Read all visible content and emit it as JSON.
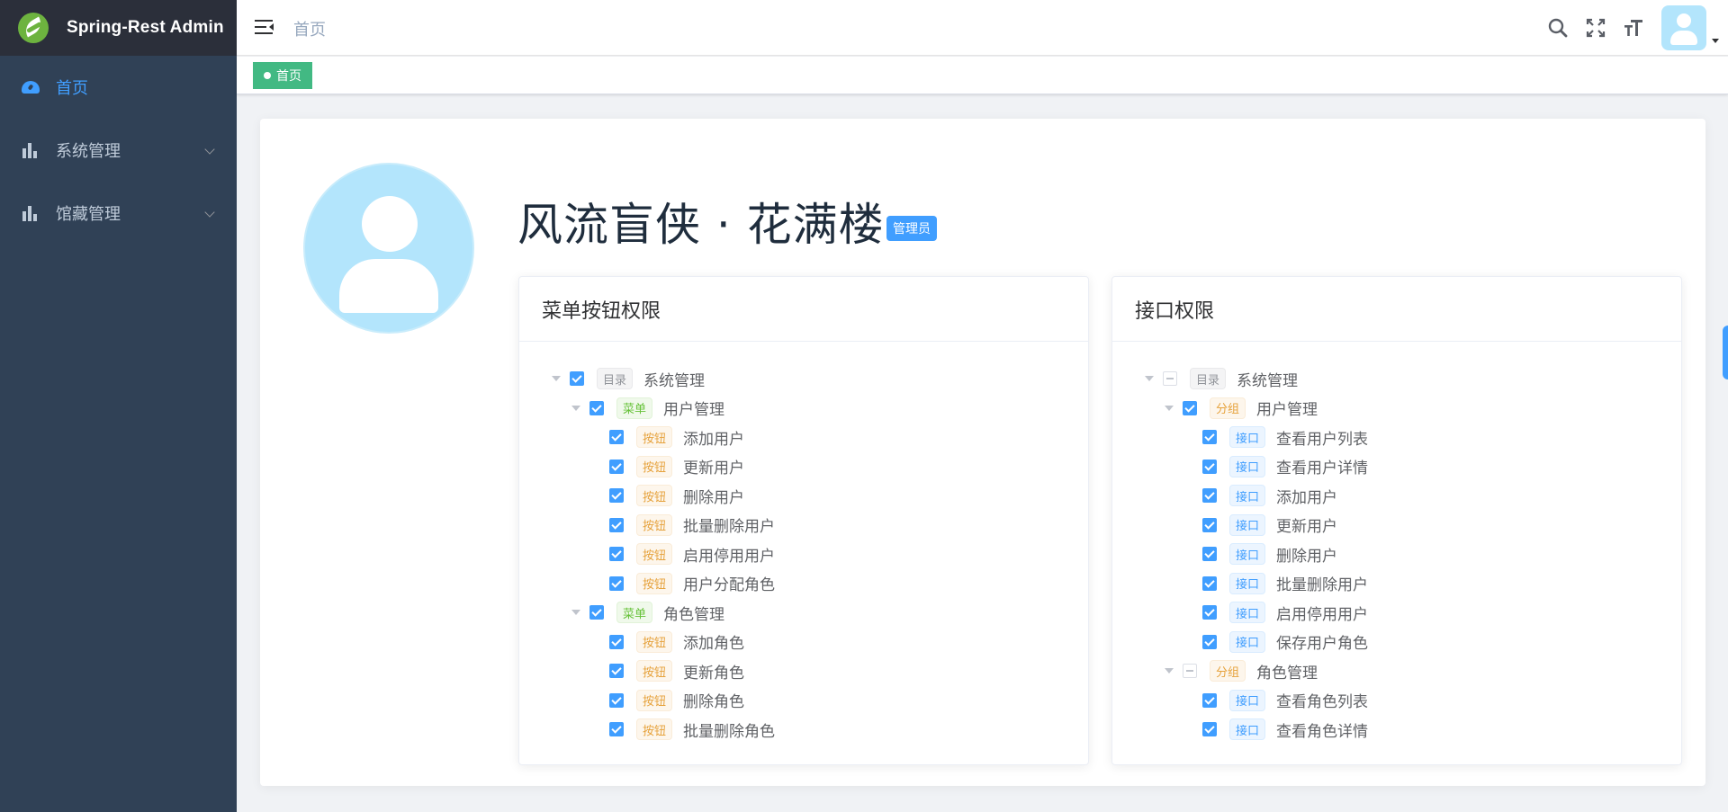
{
  "app": {
    "title": "Spring-Rest Admin"
  },
  "sidebar": {
    "items": [
      {
        "label": "首页",
        "icon": "dashboard-icon",
        "active": true
      },
      {
        "label": "系统管理",
        "icon": "bar-chart-icon",
        "expandable": true
      },
      {
        "label": "馆藏管理",
        "icon": "bar-chart-icon",
        "expandable": true
      }
    ]
  },
  "navbar": {
    "breadcrumb": "首页",
    "tools": [
      "search-icon",
      "fullscreen-icon",
      "font-size-icon"
    ]
  },
  "tags": {
    "active": "首页"
  },
  "profile": {
    "name": "风流盲侠 · 花满楼",
    "role": "管理员"
  },
  "menu_permissions": {
    "title": "菜单按钮权限",
    "nodes": [
      {
        "depth": 0,
        "expand": true,
        "check": "checked",
        "badge": "目录",
        "badge_type": "info",
        "label": "系统管理"
      },
      {
        "depth": 1,
        "expand": true,
        "check": "checked",
        "badge": "菜单",
        "badge_type": "success",
        "label": "用户管理"
      },
      {
        "depth": 2,
        "expand": false,
        "check": "checked",
        "badge": "按钮",
        "badge_type": "warning",
        "label": "添加用户"
      },
      {
        "depth": 2,
        "expand": false,
        "check": "checked",
        "badge": "按钮",
        "badge_type": "warning",
        "label": "更新用户"
      },
      {
        "depth": 2,
        "expand": false,
        "check": "checked",
        "badge": "按钮",
        "badge_type": "warning",
        "label": "删除用户"
      },
      {
        "depth": 2,
        "expand": false,
        "check": "checked",
        "badge": "按钮",
        "badge_type": "warning",
        "label": "批量删除用户"
      },
      {
        "depth": 2,
        "expand": false,
        "check": "checked",
        "badge": "按钮",
        "badge_type": "warning",
        "label": "启用停用用户"
      },
      {
        "depth": 2,
        "expand": false,
        "check": "checked",
        "badge": "按钮",
        "badge_type": "warning",
        "label": "用户分配角色"
      },
      {
        "depth": 1,
        "expand": true,
        "check": "checked",
        "badge": "菜单",
        "badge_type": "success",
        "label": "角色管理"
      },
      {
        "depth": 2,
        "expand": false,
        "check": "checked",
        "badge": "按钮",
        "badge_type": "warning",
        "label": "添加角色"
      },
      {
        "depth": 2,
        "expand": false,
        "check": "checked",
        "badge": "按钮",
        "badge_type": "warning",
        "label": "更新角色"
      },
      {
        "depth": 2,
        "expand": false,
        "check": "checked",
        "badge": "按钮",
        "badge_type": "warning",
        "label": "删除角色"
      },
      {
        "depth": 2,
        "expand": false,
        "check": "checked",
        "badge": "按钮",
        "badge_type": "warning",
        "label": "批量删除角色"
      }
    ]
  },
  "api_permissions": {
    "title": "接口权限",
    "nodes": [
      {
        "depth": 0,
        "expand": true,
        "check": "indeterminate",
        "badge": "目录",
        "badge_type": "info",
        "label": "系统管理"
      },
      {
        "depth": 1,
        "expand": true,
        "check": "checked",
        "badge": "分组",
        "badge_type": "warning",
        "label": "用户管理"
      },
      {
        "depth": 2,
        "expand": false,
        "check": "checked",
        "badge": "接口",
        "badge_type": "primary",
        "label": "查看用户列表"
      },
      {
        "depth": 2,
        "expand": false,
        "check": "checked",
        "badge": "接口",
        "badge_type": "primary",
        "label": "查看用户详情"
      },
      {
        "depth": 2,
        "expand": false,
        "check": "checked",
        "badge": "接口",
        "badge_type": "primary",
        "label": "添加用户"
      },
      {
        "depth": 2,
        "expand": false,
        "check": "checked",
        "badge": "接口",
        "badge_type": "primary",
        "label": "更新用户"
      },
      {
        "depth": 2,
        "expand": false,
        "check": "checked",
        "badge": "接口",
        "badge_type": "primary",
        "label": "删除用户"
      },
      {
        "depth": 2,
        "expand": false,
        "check": "checked",
        "badge": "接口",
        "badge_type": "primary",
        "label": "批量删除用户"
      },
      {
        "depth": 2,
        "expand": false,
        "check": "checked",
        "badge": "接口",
        "badge_type": "primary",
        "label": "启用停用用户"
      },
      {
        "depth": 2,
        "expand": false,
        "check": "checked",
        "badge": "接口",
        "badge_type": "primary",
        "label": "保存用户角色"
      },
      {
        "depth": 1,
        "expand": true,
        "check": "indeterminate",
        "badge": "分组",
        "badge_type": "warning",
        "label": "角色管理"
      },
      {
        "depth": 2,
        "expand": false,
        "check": "checked",
        "badge": "接口",
        "badge_type": "primary",
        "label": "查看角色列表"
      },
      {
        "depth": 2,
        "expand": false,
        "check": "checked",
        "badge": "接口",
        "badge_type": "primary",
        "label": "查看角色详情"
      }
    ]
  },
  "colors": {
    "sidebar_bg": "#304156",
    "accent": "#409eff",
    "tag_active": "#42b983"
  }
}
